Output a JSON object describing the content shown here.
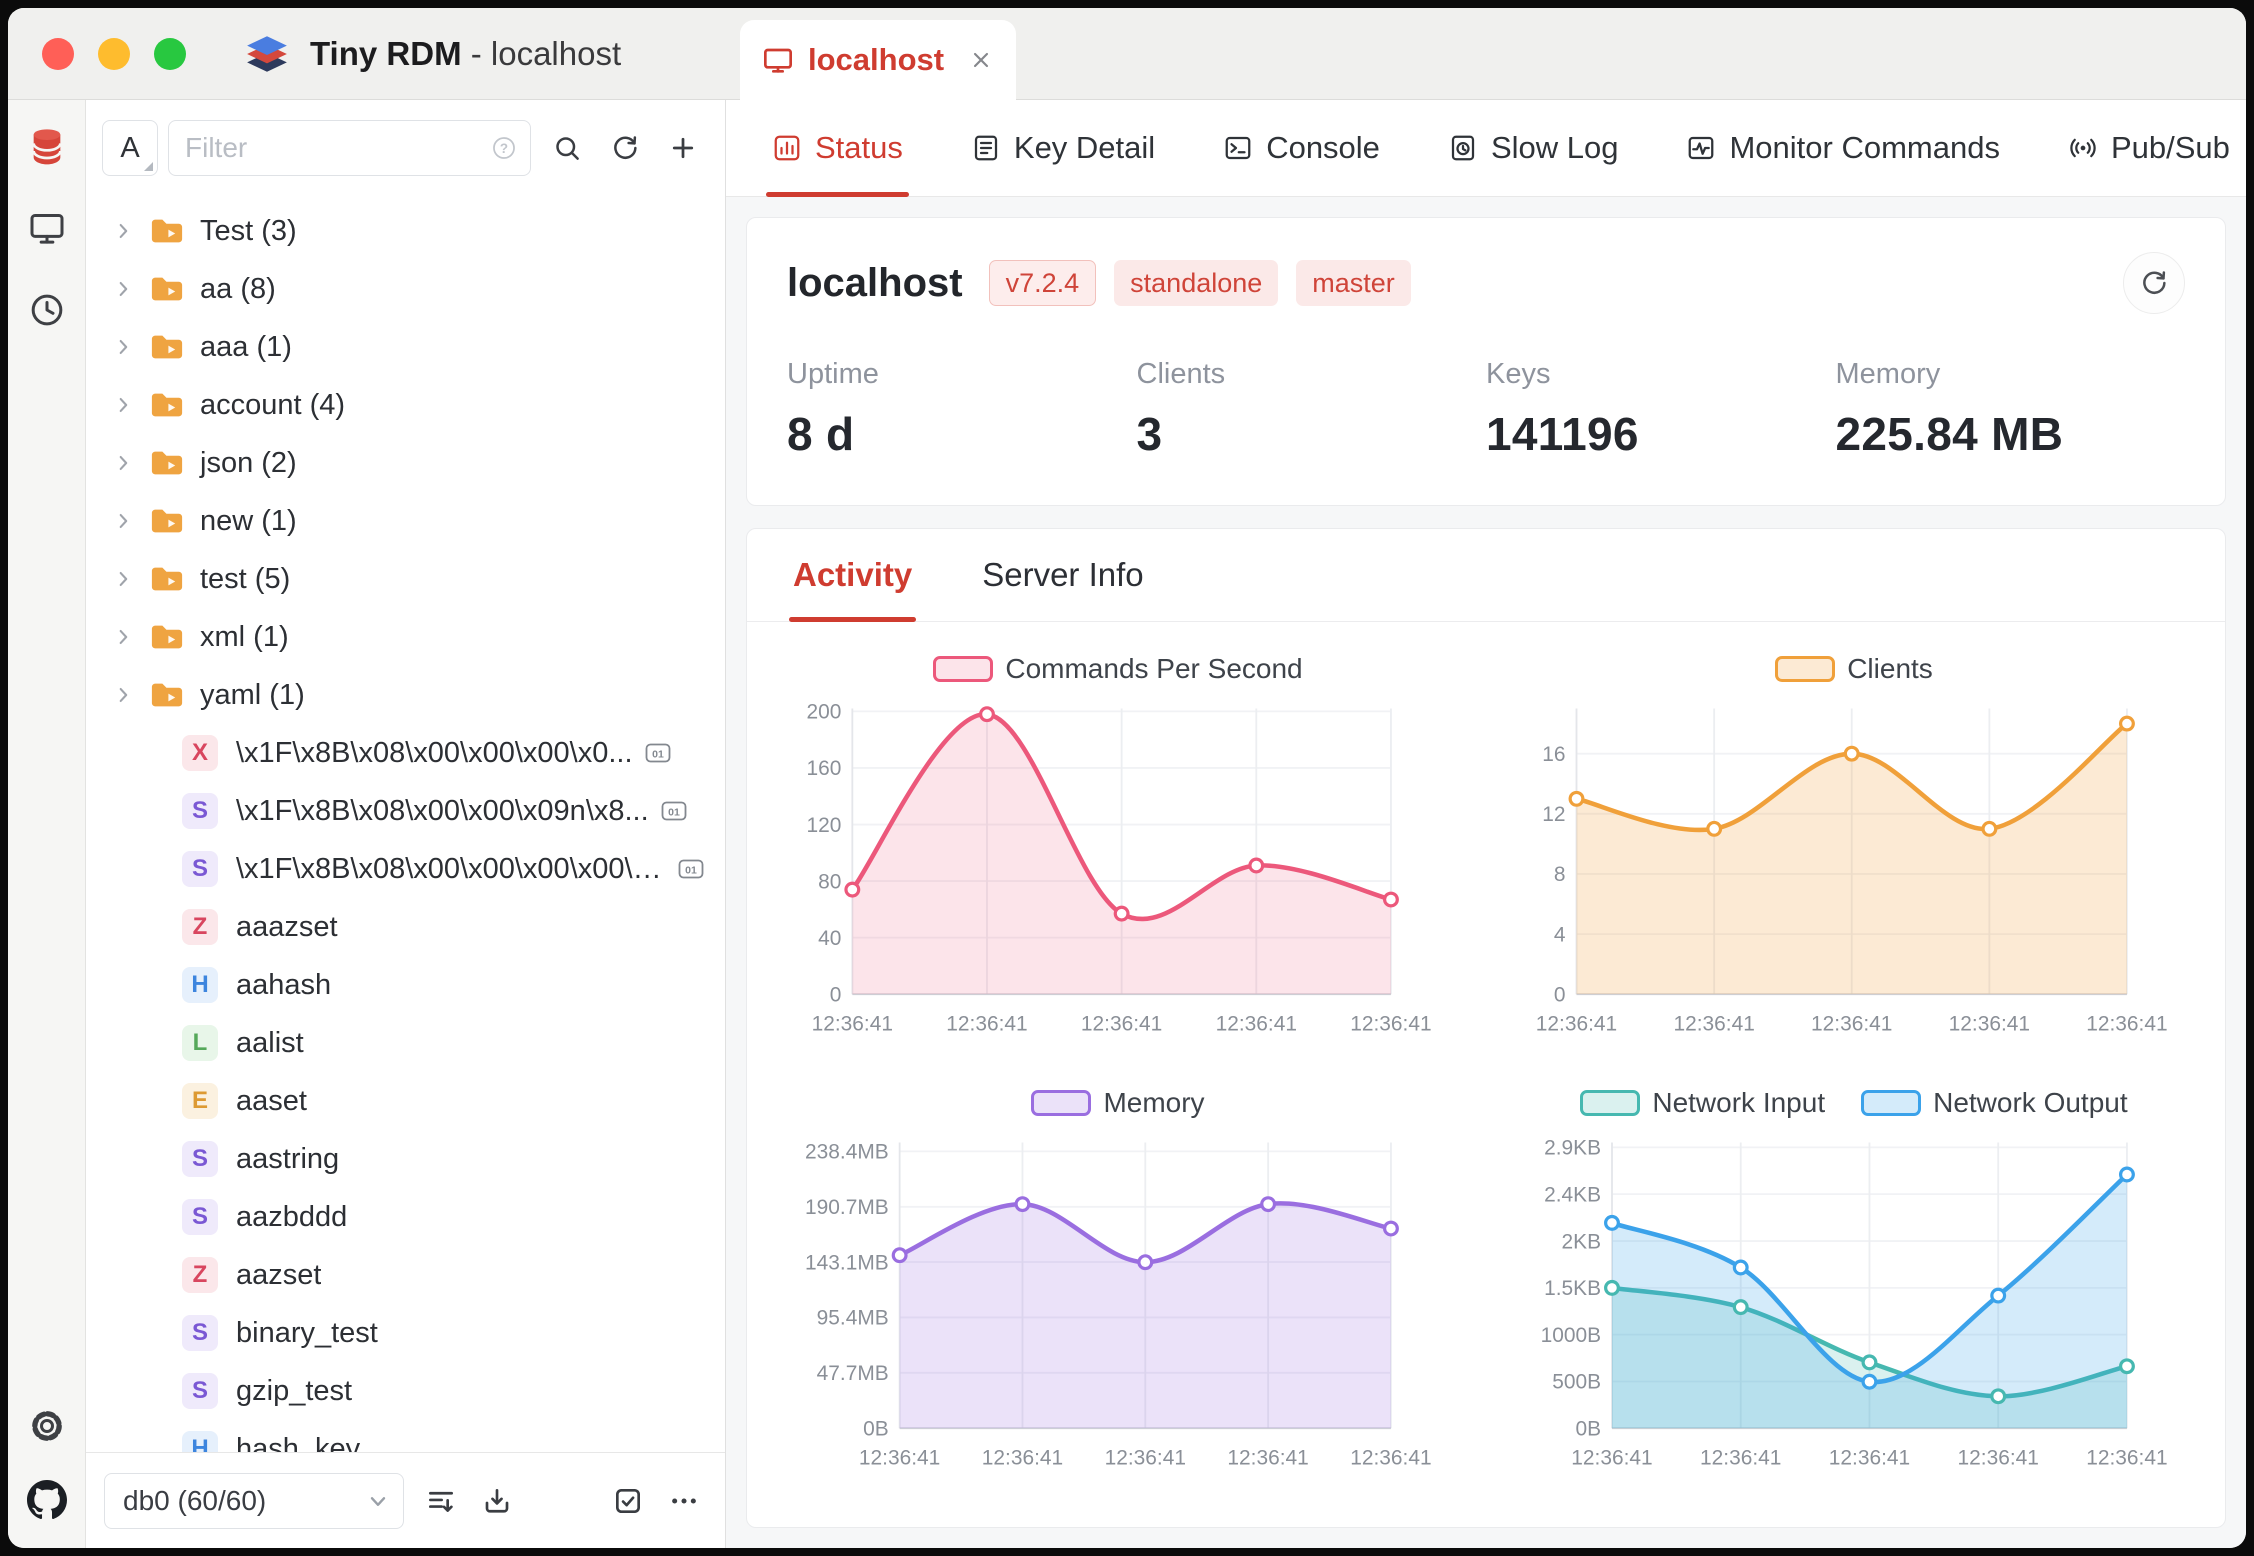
{
  "colors": {
    "accent": "#cf3c30",
    "chart_pink": "#ec587b",
    "chart_orange": "#f0a03a",
    "chart_purple": "#9a6ee0",
    "chart_teal": "#46b8b0",
    "chart_blue": "#3ba2ea"
  },
  "window": {
    "title_app": "Tiny RDM",
    "title_rest": " - localhost"
  },
  "rail": {
    "top": [
      {
        "icon": "database-icon",
        "active": true
      },
      {
        "icon": "server-icon",
        "active": false
      },
      {
        "icon": "history-icon",
        "active": false
      }
    ],
    "bottom": [
      {
        "icon": "settings-icon"
      },
      {
        "icon": "github-icon"
      }
    ]
  },
  "sidebar": {
    "filter": {
      "type_label": "A",
      "placeholder": "Filter",
      "buttons": [
        {
          "icon": "search-icon"
        },
        {
          "icon": "refresh-icon"
        },
        {
          "icon": "add-icon"
        }
      ]
    },
    "tree": {
      "type_colors": {
        "X": {
          "fg": "#d8465f",
          "bg": "#fbe7ea"
        },
        "S": {
          "fg": "#7a58d4",
          "bg": "#efeafb"
        },
        "Z": {
          "fg": "#d8465f",
          "bg": "#fbe7ea"
        },
        "H": {
          "fg": "#3d85de",
          "bg": "#e6f0fc"
        },
        "L": {
          "fg": "#55a85a",
          "bg": "#e8f6e9"
        },
        "E": {
          "fg": "#dd9a33",
          "bg": "#fbf1e0"
        }
      },
      "folders": [
        {
          "label": "Test (3)"
        },
        {
          "label": "aa (8)"
        },
        {
          "label": "aaa (1)"
        },
        {
          "label": "account (4)"
        },
        {
          "label": "json (2)"
        },
        {
          "label": "new (1)"
        },
        {
          "label": "test (5)"
        },
        {
          "label": "xml (1)"
        },
        {
          "label": "yaml (1)"
        }
      ],
      "keys": [
        {
          "type": "X",
          "label": "\\x1F\\x8B\\x08\\x00\\x00\\x00\\x0...",
          "binary": true
        },
        {
          "type": "S",
          "label": "\\x1F\\x8B\\x08\\x00\\x00\\x09n\\x8...",
          "binary": true
        },
        {
          "type": "S",
          "label": "\\x1F\\x8B\\x08\\x00\\x00\\x00\\x00\\x0...",
          "binary": true
        },
        {
          "type": "Z",
          "label": "aaazset"
        },
        {
          "type": "H",
          "label": "aahash"
        },
        {
          "type": "L",
          "label": "aalist"
        },
        {
          "type": "E",
          "label": "aaset"
        },
        {
          "type": "S",
          "label": "aastring"
        },
        {
          "type": "S",
          "label": "aazbddd"
        },
        {
          "type": "Z",
          "label": "aazset"
        },
        {
          "type": "S",
          "label": "binary_test"
        },
        {
          "type": "S",
          "label": "gzip_test"
        },
        {
          "type": "H",
          "label": "hash_key"
        }
      ]
    },
    "footer": {
      "db_label": "db0 (60/60)",
      "buttons": [
        {
          "icon": "flatten-list-icon"
        },
        {
          "icon": "import-icon"
        },
        {
          "icon": "checkbox-icon",
          "push": true
        },
        {
          "icon": "more-icon"
        }
      ]
    }
  },
  "main": {
    "tab": {
      "icon": "monitor-icon",
      "label": "localhost",
      "close_icon": "close-icon"
    },
    "nav_tabs": [
      {
        "icon": "status-icon",
        "label": "Status",
        "active": true
      },
      {
        "icon": "key-detail-icon",
        "label": "Key Detail"
      },
      {
        "icon": "console-icon",
        "label": "Console"
      },
      {
        "icon": "slowlog-icon",
        "label": "Slow Log"
      },
      {
        "icon": "monitor-commands-icon",
        "label": "Monitor Commands"
      },
      {
        "icon": "pubsub-icon",
        "label": "Pub/Sub"
      }
    ],
    "server": {
      "name": "localhost",
      "badges": [
        {
          "label": "v7.2.4",
          "bordered": true
        },
        {
          "label": "standalone"
        },
        {
          "label": "master"
        }
      ],
      "refresh_icon": "refresh-icon",
      "stats": [
        {
          "label": "Uptime",
          "value": "8 d"
        },
        {
          "label": "Clients",
          "value": "3"
        },
        {
          "label": "Keys",
          "value": "141196"
        },
        {
          "label": "Memory",
          "value": "225.84 MB"
        }
      ]
    },
    "activity_tabs": [
      {
        "label": "Activity",
        "active": true
      },
      {
        "label": "Server Info"
      }
    ]
  },
  "chart_data": [
    {
      "id": "cps",
      "type": "line",
      "title": "Commands Per Second",
      "x_labels": [
        "12:36:41",
        "12:36:41",
        "12:36:41",
        "12:36:41",
        "12:36:41"
      ],
      "y_tick_values": [
        0,
        40,
        80,
        120,
        160,
        200
      ],
      "y_tick_labels": [
        "0",
        "40",
        "80",
        "120",
        "160",
        "200"
      ],
      "ymax": 202,
      "series": [
        {
          "name": "Commands Per Second",
          "color": "#ec587b",
          "fill": "rgba(236,88,123,0.16)",
          "values": [
            74,
            198,
            57,
            91,
            67
          ]
        }
      ]
    },
    {
      "id": "clients",
      "type": "line",
      "title": "Clients",
      "x_labels": [
        "12:36:41",
        "12:36:41",
        "12:36:41",
        "12:36:41",
        "12:36:41"
      ],
      "y_tick_values": [
        0,
        4,
        8,
        12,
        16
      ],
      "y_tick_labels": [
        "0",
        "4",
        "8",
        "12",
        "16"
      ],
      "ymax": 19,
      "series": [
        {
          "name": "Clients",
          "color": "#f0a03a",
          "fill": "rgba(240,160,58,0.22)",
          "values": [
            13,
            11,
            16,
            11,
            18
          ]
        }
      ]
    },
    {
      "id": "memory",
      "type": "line",
      "title": "Memory",
      "x_labels": [
        "12:36:41",
        "12:36:41",
        "12:36:41",
        "12:36:41",
        "12:36:41"
      ],
      "y_tick_values": [
        0,
        47.7,
        95.4,
        143.1,
        190.7,
        238.4
      ],
      "y_tick_labels": [
        "0B",
        "47.7MB",
        "95.4MB",
        "143.1MB",
        "190.7MB",
        "238.4MB"
      ],
      "ymax": 246,
      "series": [
        {
          "name": "Memory",
          "color": "#9a6ee0",
          "fill": "rgba(154,110,224,0.20)",
          "values": [
            149,
            193,
            143,
            193,
            172
          ]
        }
      ]
    },
    {
      "id": "network",
      "type": "line",
      "title": "Network",
      "x_labels": [
        "12:36:41",
        "12:36:41",
        "12:36:41",
        "12:36:41",
        "12:36:41"
      ],
      "y_tick_values": [
        0,
        483,
        967,
        1450,
        1933,
        2417,
        2900
      ],
      "y_tick_labels": [
        "0B",
        "500B",
        "1000B",
        "1.5KB",
        "2KB",
        "2.4KB",
        "2.9KB"
      ],
      "ymax": 2950,
      "series": [
        {
          "name": "Network Input",
          "color": "#46b8b0",
          "fill": "rgba(70,184,176,0.20)",
          "values": [
            1450,
            1250,
            680,
            330,
            640
          ]
        },
        {
          "name": "Network Output",
          "color": "#3ba2ea",
          "fill": "rgba(59,162,234,0.22)",
          "values": [
            2120,
            1660,
            480,
            1370,
            2620
          ]
        }
      ]
    }
  ]
}
